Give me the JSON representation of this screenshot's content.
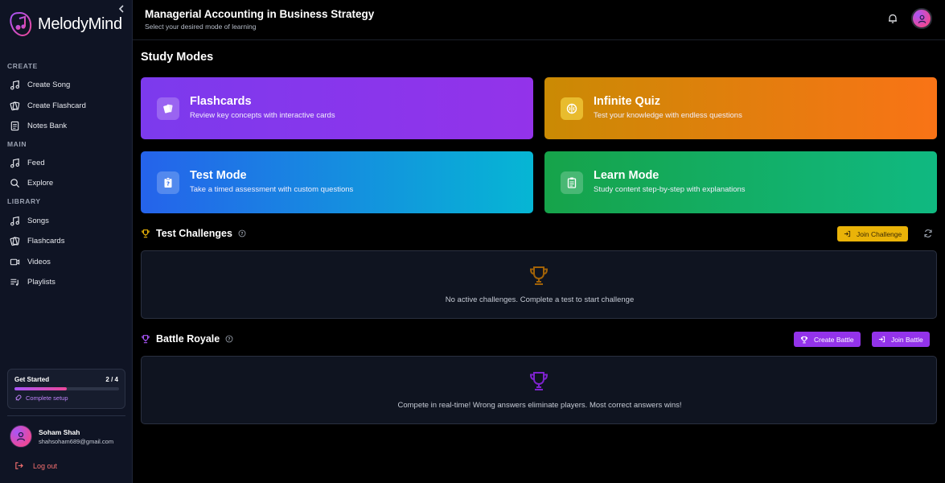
{
  "brand": {
    "name": "MelodyMind"
  },
  "sidebar": {
    "sections": {
      "create": "CREATE",
      "main": "MAIN",
      "library": "LIBRARY"
    },
    "items": [
      {
        "label": "Create Song",
        "icon": "music-note-icon"
      },
      {
        "label": "Create Flashcard",
        "icon": "cards-icon"
      },
      {
        "label": "Notes Bank",
        "icon": "document-icon"
      },
      {
        "label": "Feed",
        "icon": "music-note-icon"
      },
      {
        "label": "Explore",
        "icon": "search-icon"
      },
      {
        "label": "Songs",
        "icon": "music-note-icon"
      },
      {
        "label": "Flashcards",
        "icon": "cards-icon"
      },
      {
        "label": "Videos",
        "icon": "video-icon"
      },
      {
        "label": "Playlists",
        "icon": "playlist-icon"
      }
    ],
    "get_started": {
      "title": "Get Started",
      "count": "2 / 4",
      "progress": 0.5,
      "link": "Complete setup"
    },
    "user": {
      "name": "Soham Shah",
      "email": "shahsoham689@gmail.com"
    },
    "logout": "Log out"
  },
  "header": {
    "title": "Managerial Accounting in Business Strategy",
    "subtitle": "Select your desired mode of learning"
  },
  "main": {
    "study_title": "Study Modes",
    "modes": [
      {
        "title": "Flashcards",
        "desc": "Review key concepts with interactive cards",
        "icon": "cards-icon"
      },
      {
        "title": "Infinite Quiz",
        "desc": "Test your knowledge with endless questions",
        "icon": "brain-icon"
      },
      {
        "title": "Test Mode",
        "desc": "Take a timed assessment with custom questions",
        "icon": "clipboard-question-icon"
      },
      {
        "title": "Learn Mode",
        "desc": "Study content step-by-step with explanations",
        "icon": "clipboard-list-icon"
      }
    ],
    "test_challenges": {
      "title": "Test Challenges",
      "join_button": "Join Challenge",
      "empty_msg": "No active challenges. Complete a test to start challenge"
    },
    "battle_royale": {
      "title": "Battle Royale",
      "create_button": "Create Battle",
      "join_button": "Join Battle",
      "msg": "Compete in real-time! Wrong answers eliminate players. Most correct answers wins!"
    }
  },
  "colors": {
    "sidebar_bg": "#0f1424",
    "accent_purple": "#9333ea",
    "accent_orange": "#f59e0b",
    "logout_red": "#f87171",
    "trophy_gold": "#ca8a04",
    "trophy_purple": "#7e22ce"
  }
}
